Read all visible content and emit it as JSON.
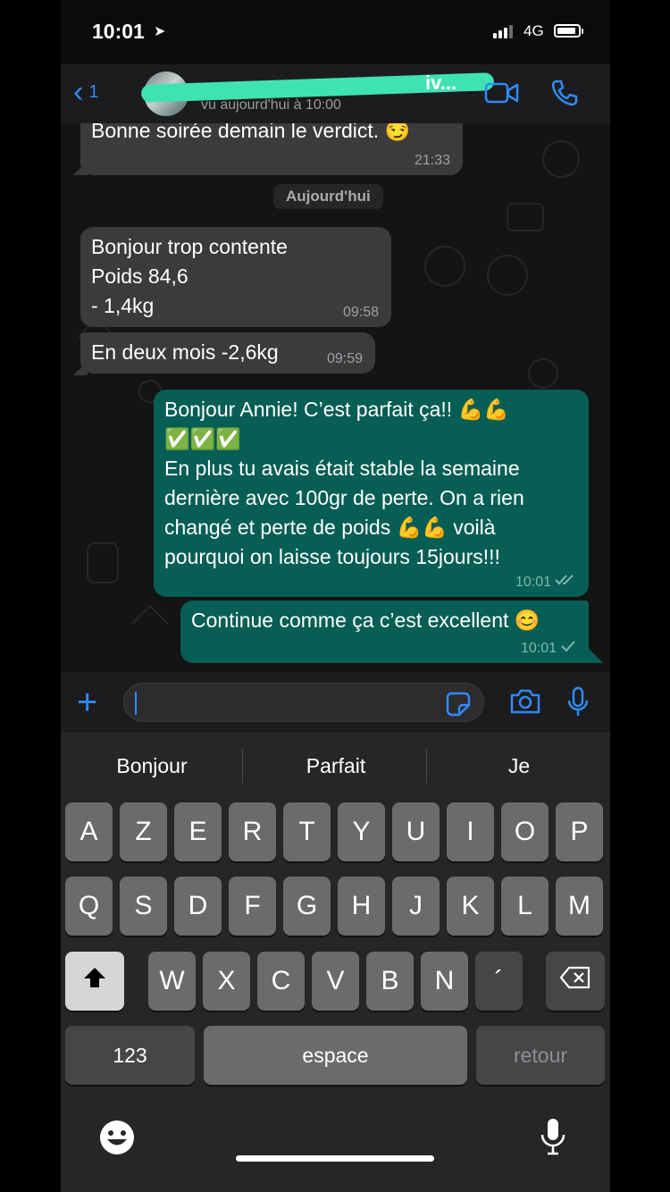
{
  "status_bar": {
    "time": "10:01",
    "network": "4G"
  },
  "header": {
    "back_count": "1",
    "contact_name_suffix": "iv...",
    "last_seen": "vu aujourd'hui à 10:00"
  },
  "chat": {
    "date_separator": "Aujourd'hui",
    "messages": [
      {
        "dir": "in",
        "text": "Bonne soirée demain le verdict. 😏",
        "time": "21:33"
      },
      {
        "dir": "in",
        "text": "Bonjour trop contente\nPoids 84,6\n- 1,4kg",
        "time": "09:58"
      },
      {
        "dir": "in",
        "text": "En deux mois -2,6kg",
        "time": "09:59"
      },
      {
        "dir": "out",
        "text": "Bonjour Annie! C’est parfait ça!! 💪💪\n✅✅✅\nEn plus tu avais était stable la semaine\ndernière avec 100gr de perte. On a rien\nchangé et perte de poids 💪💪 voilà\npourquoi on laisse toujours 15jours!!!",
        "time": "10:01"
      },
      {
        "dir": "out",
        "text": "Continue comme ça c’est excellent 😊",
        "time": "10:01"
      }
    ]
  },
  "keyboard": {
    "suggestions": [
      "Bonjour",
      "Parfait",
      "Je"
    ],
    "row1": [
      "A",
      "Z",
      "E",
      "R",
      "T",
      "Y",
      "U",
      "I",
      "O",
      "P"
    ],
    "row2": [
      "Q",
      "S",
      "D",
      "F",
      "G",
      "H",
      "J",
      "K",
      "L",
      "M"
    ],
    "row3": [
      "W",
      "X",
      "C",
      "V",
      "B",
      "N",
      "´"
    ],
    "numbers_label": "123",
    "space_label": "espace",
    "return_label": "retour"
  },
  "colors": {
    "accent": "#2f8bf6",
    "outgoing": "#075e54",
    "incoming": "#3b3b3d"
  },
  "icons": [
    "back-chevron-icon",
    "video-call-icon",
    "phone-icon",
    "plus-icon",
    "sticker-icon",
    "camera-icon",
    "microphone-icon",
    "shift-icon",
    "backspace-icon",
    "emoji-icon",
    "dictation-icon"
  ]
}
